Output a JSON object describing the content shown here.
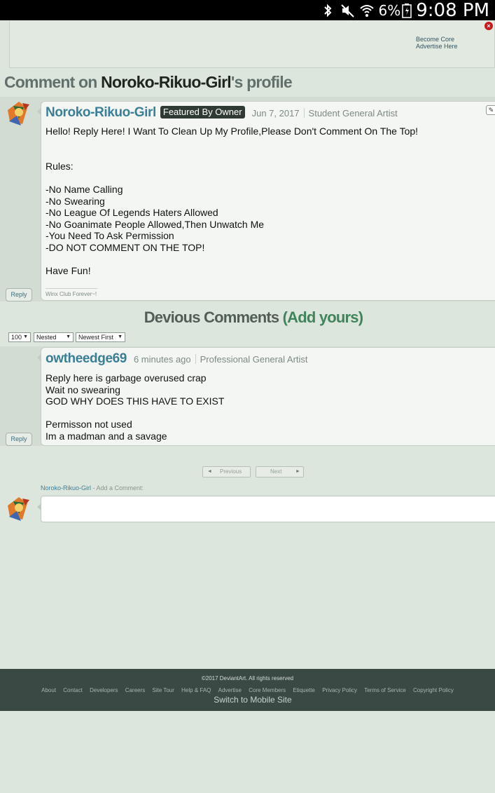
{
  "status_bar": {
    "battery": "6%",
    "time": "9:08 PM",
    "icons": [
      "bluetooth-icon",
      "mute-icon",
      "wifi-icon",
      "battery-icon"
    ]
  },
  "ad": {
    "close": "×",
    "link1": "Become Core",
    "link2": "Advertise Here"
  },
  "heading": {
    "prefix": "Comment on ",
    "user": "Noroko-Rikuo-Girl",
    "suffix": "'s profile"
  },
  "featured_comment": {
    "username": "Noroko-Rikuo-Girl",
    "badge": "Featured By Owner",
    "date": "Jun 7, 2017",
    "role": "Student General Artist",
    "lines": [
      "Hello! Reply Here! I Want To Clean Up My Profile,Please Don't Comment On The Top!",
      "",
      "",
      "Rules:",
      "",
      "-No Name Calling",
      "-No Swearing",
      "-No League Of Legends Haters Allowed",
      "-No Goanimate People Allowed,Then Unwatch Me",
      "-You Need To Ask Permission",
      "-DO NOT COMMENT ON THE TOP!",
      "",
      "Have Fun!"
    ],
    "signature": "Winx Club Forever~!",
    "reply_label": "Reply",
    "edit_icon": "✎"
  },
  "comments_section": {
    "title": "Devious Comments",
    "paren_open": "(",
    "add_label": "Add yours",
    "paren_close": ")",
    "per_page": "100",
    "view_mode": "Nested",
    "sort": "Newest First",
    "dropdown_arrow": "▼"
  },
  "reply_comment": {
    "username": "owtheedge69",
    "date": "6 minutes ago",
    "role": "Professional General Artist",
    "lines": [
      "Reply here is garbage overused crap",
      "Wait no swearing",
      "GOD WHY DOES THIS HAVE TO EXIST",
      "",
      "Permisson not used",
      "Im a madman and a savage"
    ],
    "reply_label": "Reply"
  },
  "pager": {
    "previous": "Previous",
    "next": "Next",
    "prev_arrow": "◄",
    "next_arrow": "►"
  },
  "add_comment": {
    "user": "Noroko-Rikuo-Girl",
    "label": " - Add a Comment:"
  },
  "footer": {
    "copyright": "©2017 DeviantArt. All rights reserved",
    "links": [
      "About",
      "Contact",
      "Developers",
      "Careers",
      "Site Tour",
      "Help & FAQ",
      "Advertise",
      "Core Members",
      "Etiquette",
      "Privacy Policy",
      "Terms of Service",
      "Copyright Policy"
    ],
    "mobile": "Switch to Mobile Site"
  }
}
